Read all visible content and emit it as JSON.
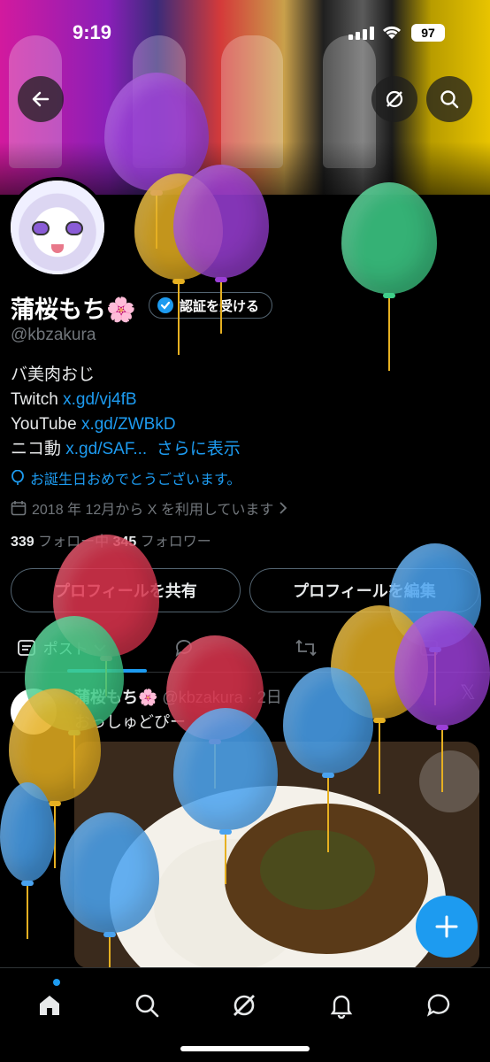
{
  "status": {
    "time": "9:19",
    "battery": "97"
  },
  "header": {
    "back_icon": "arrow-left-icon",
    "grok_icon": "grok-icon",
    "search_icon": "search-icon"
  },
  "profile": {
    "name": "蒲桜もち🌸",
    "verify_label": "認証を受ける",
    "handle": "@kbzakura",
    "bio_line1": "バ美肉おじ",
    "twitch_label": "Twitch ",
    "twitch_link": "x.gd/vj4fB",
    "youtube_label": "YouTube ",
    "youtube_link": "x.gd/ZWBkD",
    "nico_label": "ニコ動 ",
    "nico_link": "x.gd/SAF...",
    "show_more": "さらに表示",
    "birthday": "お誕生日おめでとうございます。",
    "joined": "2018 年 12月から X を利用しています",
    "following_count": "339",
    "following_label": " フォロー中  ",
    "followers_count": "345",
    "followers_label": " フォロワー",
    "share_button": "プロフィールを共有",
    "edit_button": "プロフィールを編集"
  },
  "tabs": {
    "posts_label": "ポスト"
  },
  "post": {
    "author": "蒲桜もち🌸",
    "meta": " @kbzakura · 2日",
    "text": "おっしゅどぴー"
  },
  "colors": {
    "accent": "#1d9bf0",
    "balloon_red": "#e0354f",
    "balloon_blue": "#4aa3f0",
    "balloon_green": "#3fd08a",
    "balloon_yellow": "#e6b021",
    "balloon_purple": "#9b3fd6"
  }
}
